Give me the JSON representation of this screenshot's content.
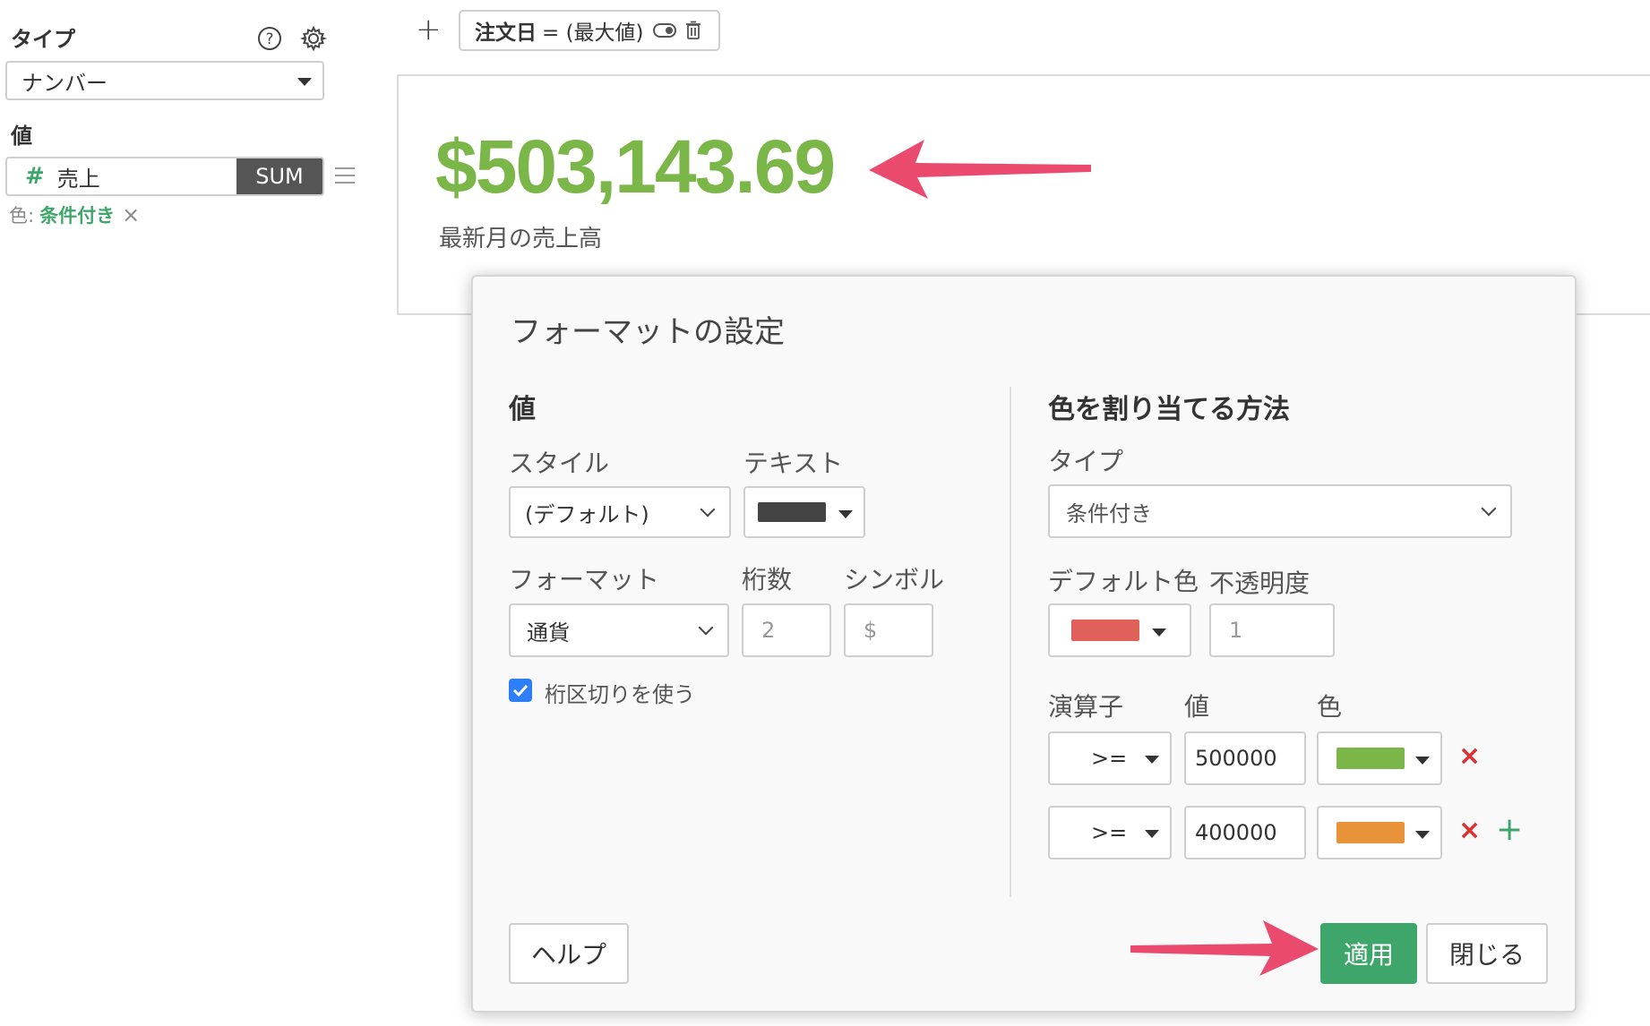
{
  "sidebar": {
    "type_label": "タイプ",
    "type_select_value": "ナンバー",
    "value_label": "値",
    "field_icon": "#",
    "field_name": "売上",
    "aggregation": "SUM",
    "color_prefix": "色:",
    "color_value": "条件付き",
    "remove_color": "×"
  },
  "filter_bar": {
    "add": "+",
    "chip_key": "注文日",
    "chip_value": "= (最大値)"
  },
  "kpi": {
    "value": "$503,143.69",
    "subtitle": "最新月の売上高",
    "value_color": "#7ab648"
  },
  "modal": {
    "title": "フォーマットの設定",
    "value_section": {
      "title": "値",
      "style_label": "スタイル",
      "style_value": "(デフォルト)",
      "text_label": "テキスト",
      "text_color": "#444444",
      "format_label": "フォーマット",
      "format_value": "通貨",
      "digits_label": "桁数",
      "digits_placeholder": "2",
      "symbol_label": "シンボル",
      "symbol_placeholder": "$",
      "separator_label": "桁区切りを使う",
      "separator_checked": true
    },
    "color_section": {
      "title": "色を割り当てる方法",
      "type_label": "タイプ",
      "type_value": "条件付き",
      "default_color_label": "デフォルト色",
      "default_color": "#e0605a",
      "opacity_label": "不透明度",
      "opacity_placeholder": "1",
      "operator_label": "演算子",
      "value_label": "値",
      "color_label": "色",
      "rules": [
        {
          "operator": ">=",
          "value": "500000",
          "color": "#7ab648"
        },
        {
          "operator": ">=",
          "value": "400000",
          "color": "#e8923a"
        }
      ],
      "remove": "×",
      "add": "+"
    },
    "help_button": "ヘルプ",
    "apply_button": "適用",
    "close_button": "閉じる"
  },
  "colors": {
    "annotation_arrow": "#ea4a6e",
    "accent_green": "#3fa66b",
    "remove_red": "#e03131"
  }
}
